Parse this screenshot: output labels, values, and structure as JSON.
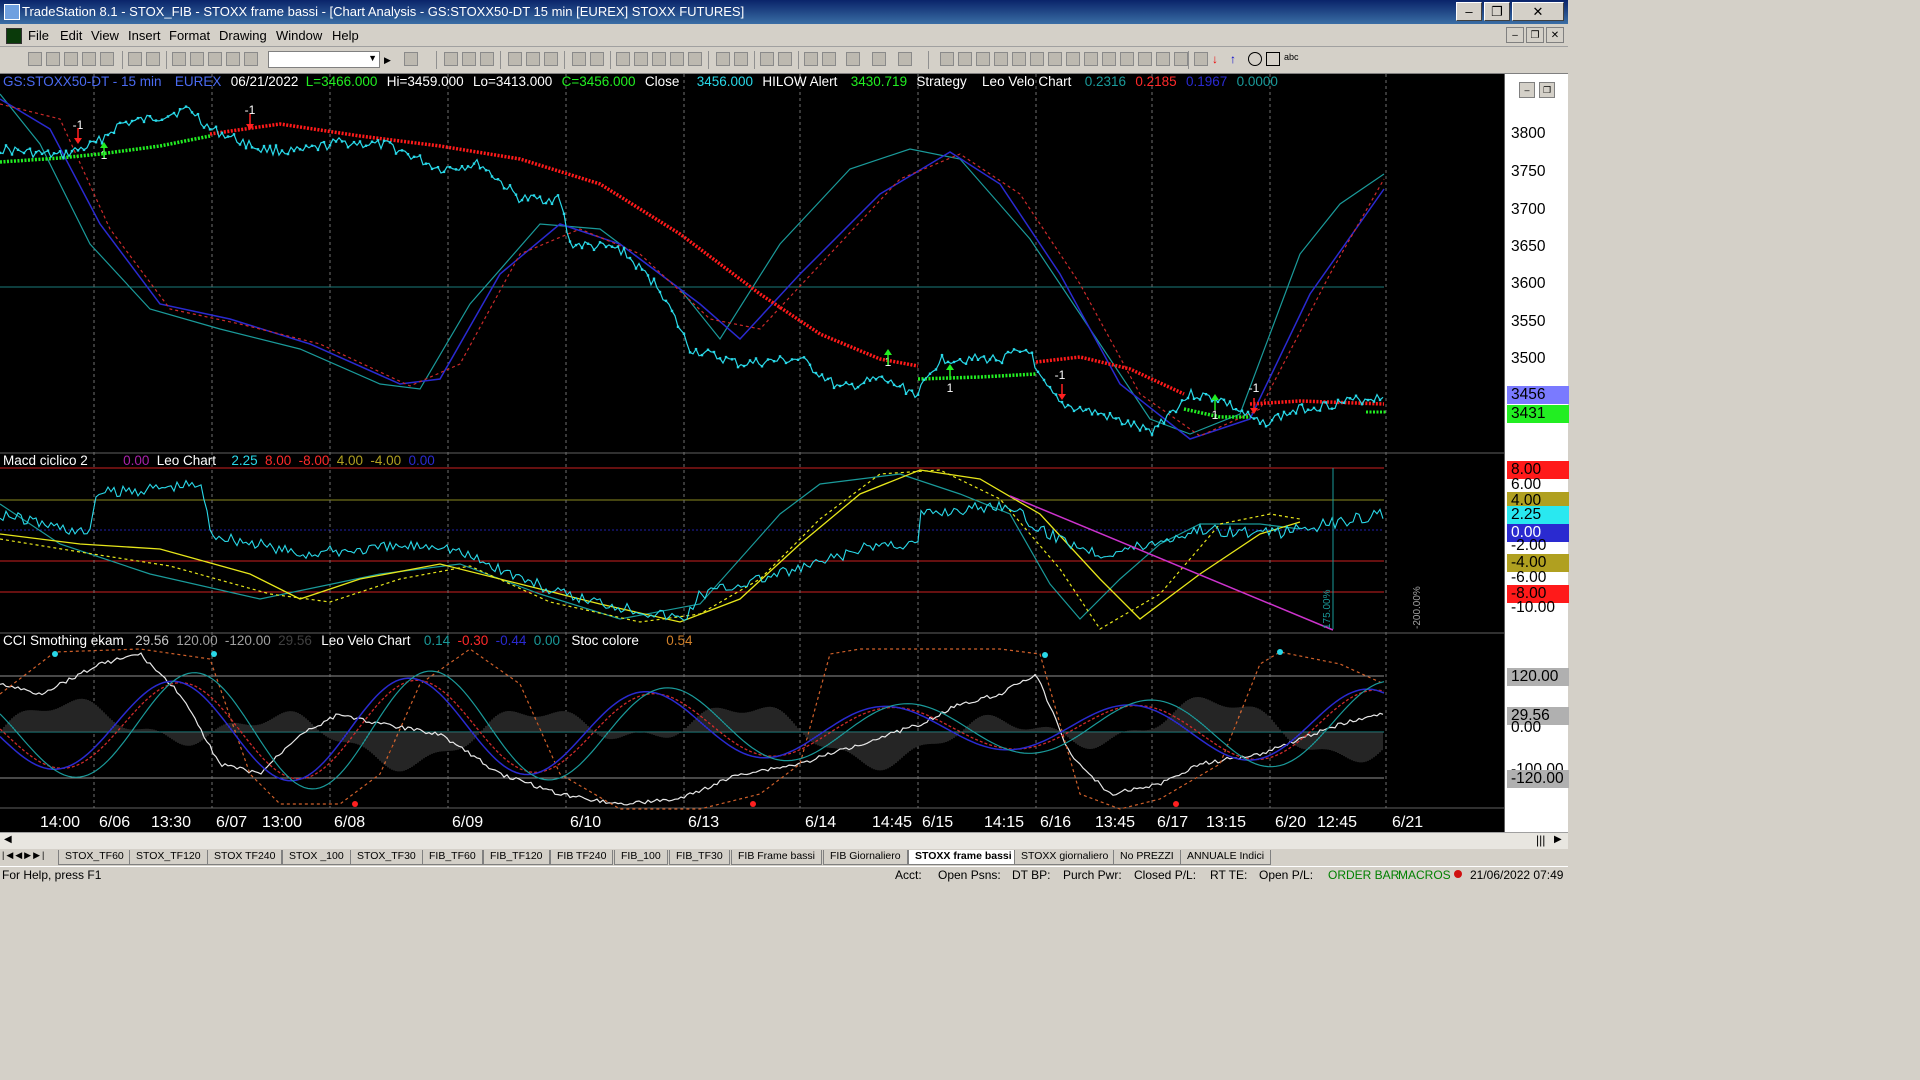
{
  "window": {
    "title": "TradeStation 8.1 - STOX_FIB - STOXX frame bassi - [Chart Analysis - GS:STOXX50-DT  15 min  [EUREX] STOXX FUTURES]",
    "minimize_icon": "minimize-icon",
    "restore_icon": "restore-icon",
    "close_icon": "close-icon"
  },
  "menu": {
    "items": [
      "File",
      "Edit",
      "View",
      "Insert",
      "Format",
      "Drawing",
      "Window",
      "Help"
    ]
  },
  "toolbar": {
    "symbol_value": ""
  },
  "price_panel": {
    "symbol": "GS:STOXX50-DT - 15 min",
    "exchange": "EUREX",
    "date": "06/21/2022",
    "last": "L=3466.000",
    "high": "Hi=3459.000",
    "low": "Lo=3413.000",
    "close_eq": "C=3456.000",
    "close_label": "Close",
    "close_value": "3456.000",
    "hilow_label": "HILOW Alert",
    "hilow_value": "3430.719",
    "strategy_label": "Strategy",
    "leo_label": "Leo Velo Chart",
    "leo_v1": "0.2316",
    "leo_v2": "0.2185",
    "leo_v3": "0.1967",
    "leo_v4": "0.0000",
    "yticks": [
      "3800",
      "3750",
      "3700",
      "3650",
      "3600",
      "3550",
      "3500"
    ],
    "price_tag": "3456",
    "hilow_tag": "3431",
    "signals": [
      "-1",
      "1",
      "-1",
      "1",
      "-1",
      "1",
      "1",
      "-1",
      "1"
    ]
  },
  "macd_panel": {
    "name": "Macd ciclico 2",
    "v0": "0.00",
    "leo_label": "Leo Chart",
    "v1": "2.25",
    "v2": "8.00",
    "v3": "-8.00",
    "v4": "4.00",
    "v5": "-4.00",
    "v6": "0.00",
    "yticks": [
      "8.00",
      "6.00",
      "4.00",
      "2.25",
      "0.00",
      "-2.00",
      "-4.00",
      "-6.00",
      "-8.00",
      "-10.00"
    ],
    "pct1": "175.00%",
    "pct2": "-200.00%"
  },
  "cci_panel": {
    "name": "CCI Smothing ekam",
    "v1": "29.56",
    "v2": "120.00",
    "v3": "-120.00",
    "v4": "29.56",
    "leo_label": "Leo Velo Chart",
    "lv1": "0.14",
    "lv2": "-0.30",
    "lv3": "-0.44",
    "lv4": "0.00",
    "stoc_label": "Stoc colore",
    "stoc_value": "0.54",
    "yticks": [
      "120.00",
      "29.56",
      "0.00",
      "-100.00",
      "-120.00"
    ]
  },
  "xaxis": {
    "labels": [
      "14:00",
      "6/06",
      "13:30",
      "6/07",
      "13:00",
      "6/08",
      "6/09",
      "6/10",
      "6/13",
      "6/14",
      "14:45",
      "6/15",
      "14:15",
      "6/16",
      "13:45",
      "6/17",
      "13:15",
      "6/20",
      "12:45",
      "6/21"
    ]
  },
  "tabs": {
    "items": [
      "STOX_TF60",
      "STOX_TF120",
      "STOX TF240",
      "STOX _100",
      "STOX_TF30",
      "FIB_TF60",
      "FIB_TF120",
      "FIB TF240",
      "FIB_100",
      "FIB_TF30",
      "FIB Frame bassi",
      "FIB Giornaliero",
      "STOXX frame bassi",
      "STOXX giornaliero",
      "No PREZZI",
      "ANNUALE Indici"
    ],
    "active": "STOXX frame bassi"
  },
  "status": {
    "help": "For Help, press F1",
    "acct": "Acct:",
    "open_psns": "Open Psns:",
    "dt_bp": "DT BP:",
    "purch_pwr": "Purch Pwr:",
    "closed_pl": "Closed P/L:",
    "rt_te": "RT TE:",
    "open_pl": "Open P/L:",
    "order_bar": "ORDER BAR",
    "macros": "MACROS",
    "datetime": "21/06/2022 07:49"
  },
  "colors": {
    "price_dots": "#29d8e8",
    "hilow_red": "#ff1a1a",
    "hilow_green": "#22ee22",
    "osc_blue": "#2a2ad0",
    "osc_teal": "#1a9a9a",
    "osc_red_dashed": "#cc2a2a",
    "macd_yellow": "#e6e61a",
    "trend_magenta": "#cc33cc",
    "cci_white": "#e8e8e8",
    "cci_orange_dashed": "#d0602a"
  }
}
